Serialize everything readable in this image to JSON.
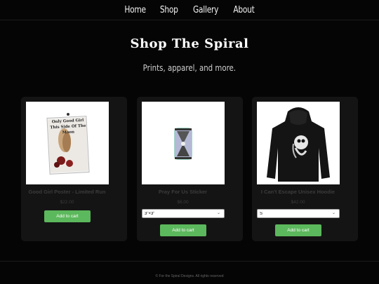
{
  "nav": {
    "items": [
      {
        "label": "Home"
      },
      {
        "label": "Shop"
      },
      {
        "label": "Gallery"
      },
      {
        "label": "About"
      }
    ]
  },
  "header": {
    "title": "Shop The Spiral",
    "subtitle": "Prints, apparel, and more."
  },
  "products": [
    {
      "name": "Good Girl Poster - Limited Run",
      "price": "$22.00",
      "button": "Add to cart",
      "poster_text": [
        "Only Good Girl This Side Of The Moon"
      ]
    },
    {
      "name": "Pray For Us Sticker",
      "price": "$6.00",
      "option": "3\"×3\"",
      "button": "Add to cart"
    },
    {
      "name": "I Can't Escape Unisex Hoodie",
      "price": "$42.00",
      "option": "S",
      "button": "Add to cart"
    }
  ],
  "footer": {
    "text": "© For the Spiral Designs. All rights reserved"
  },
  "colors": {
    "background": "#050505",
    "card": "#141414",
    "button": "#5cb85c"
  }
}
